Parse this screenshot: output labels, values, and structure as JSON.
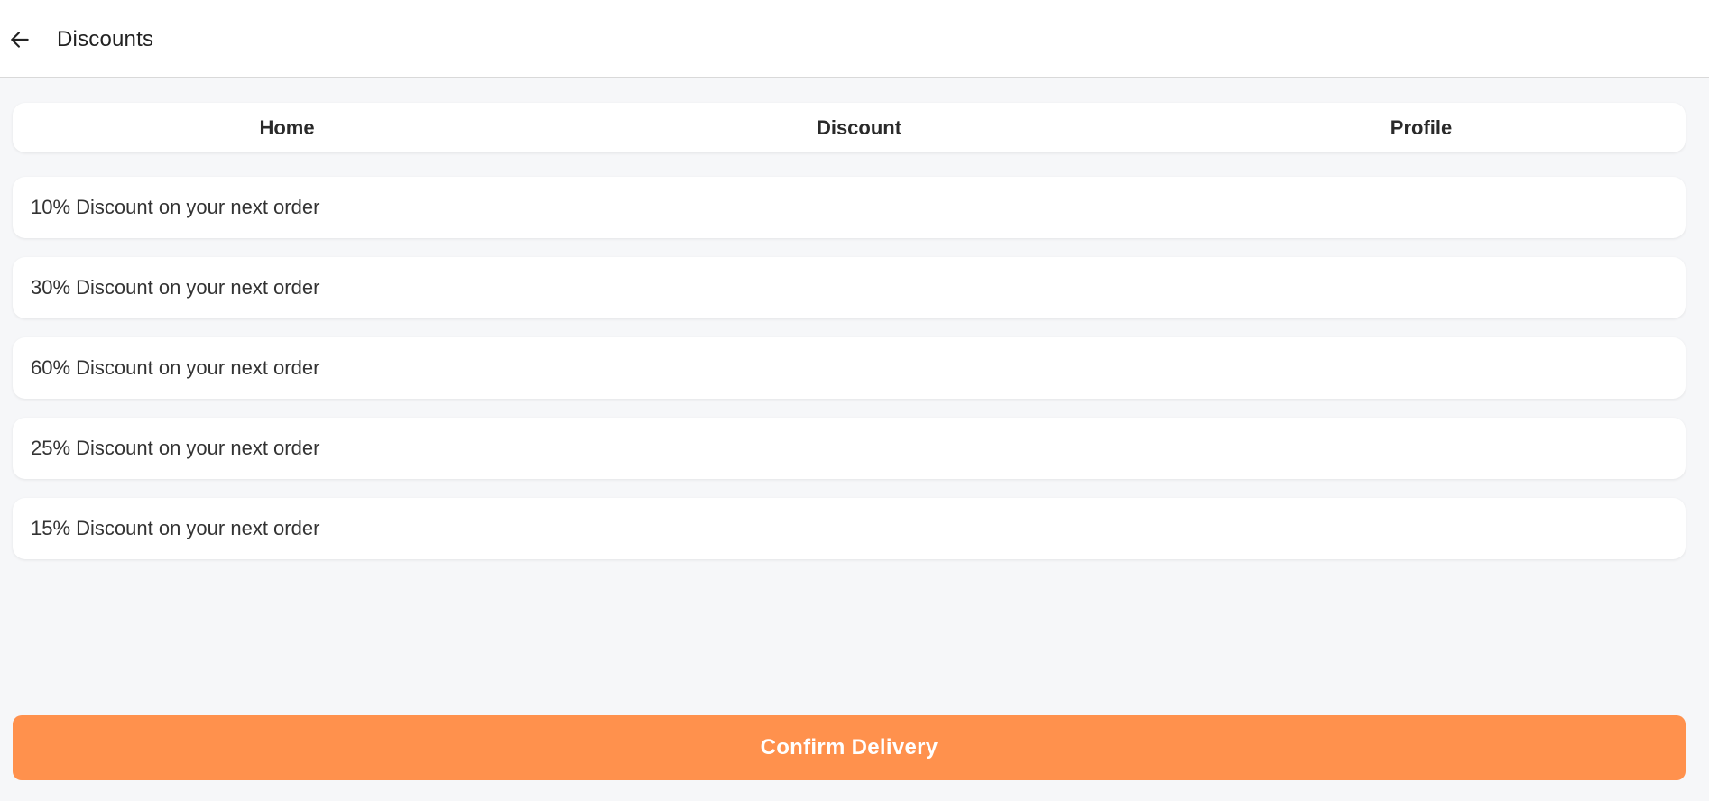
{
  "header": {
    "back_icon": "arrow-left-icon",
    "title": "Discounts"
  },
  "tabs": [
    {
      "label": "Home"
    },
    {
      "label": "Discount"
    },
    {
      "label": "Profile"
    }
  ],
  "discounts": [
    {
      "label": "10% Discount on your next order"
    },
    {
      "label": "30% Discount on your next order"
    },
    {
      "label": "60% Discount on your next order"
    },
    {
      "label": "25% Discount on your next order"
    },
    {
      "label": "15% Discount on your next order"
    }
  ],
  "footer": {
    "confirm_label": "Confirm Delivery"
  },
  "colors": {
    "accent": "#ff914d",
    "background": "#f6f7f9",
    "card": "#ffffff"
  }
}
